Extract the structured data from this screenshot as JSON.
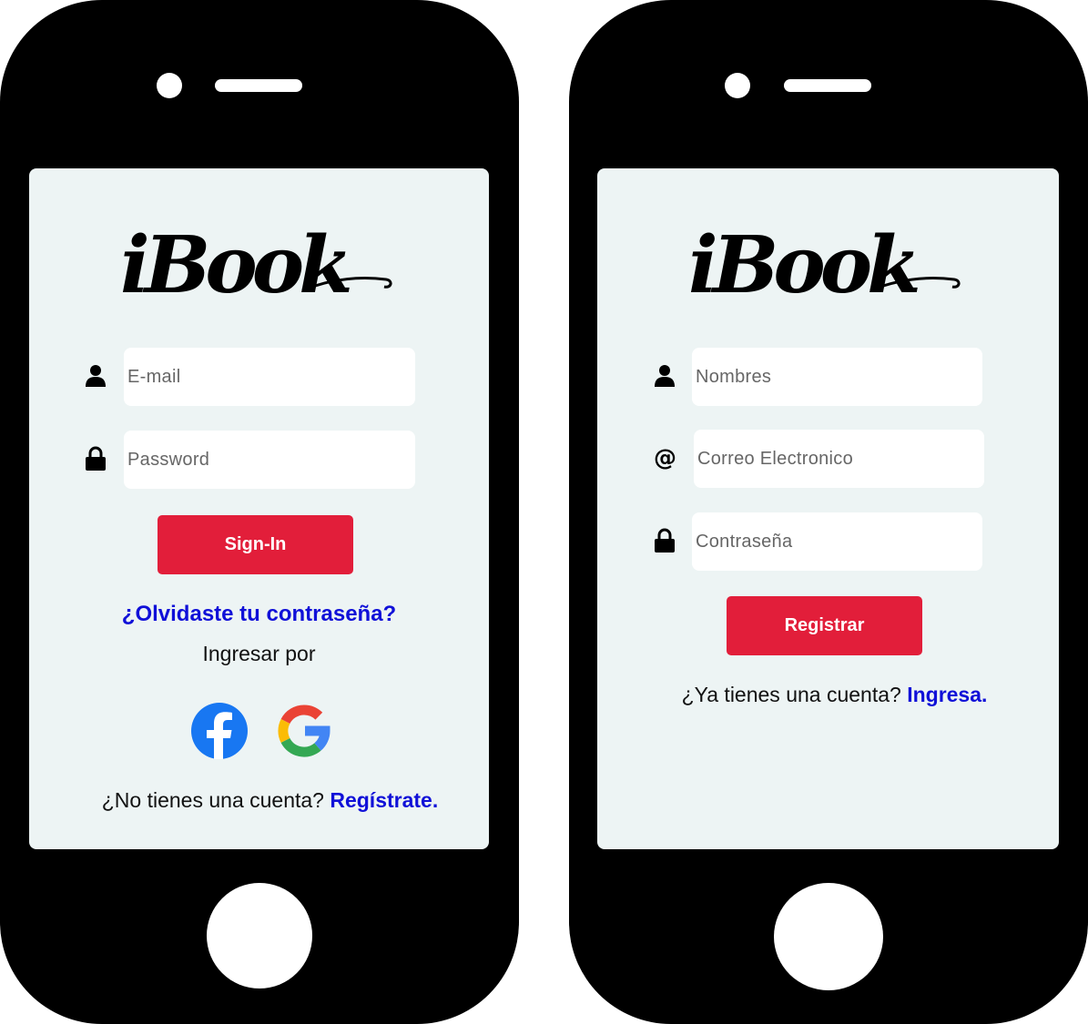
{
  "login": {
    "logo_text": "iBook",
    "email_placeholder": "E-mail",
    "password_placeholder": "Password",
    "signin_label": "Sign-In",
    "forgot_link": "¿Olvidaste tu contraseña?",
    "ingresar_por": "Ingresar por",
    "no_account_text": "¿No tienes una cuenta?",
    "register_link": "Regístrate."
  },
  "register": {
    "logo_text": "iBook",
    "names_placeholder": "Nombres",
    "email_placeholder": "Correo Electronico",
    "password_placeholder": "Contraseña",
    "register_label": "Registrar",
    "have_account_text": "¿Ya tienes una cuenta?",
    "login_link": "Ingresa."
  },
  "icons": {
    "user": "user-icon",
    "lock": "lock-icon",
    "at": "@",
    "facebook": "facebook-icon",
    "google": "google-icon"
  },
  "colors": {
    "phone_body": "#000000",
    "screen_bg": "#edf4f4",
    "button_red": "#e21e3a",
    "link_blue": "#1010d8",
    "facebook_blue": "#1877f2"
  }
}
